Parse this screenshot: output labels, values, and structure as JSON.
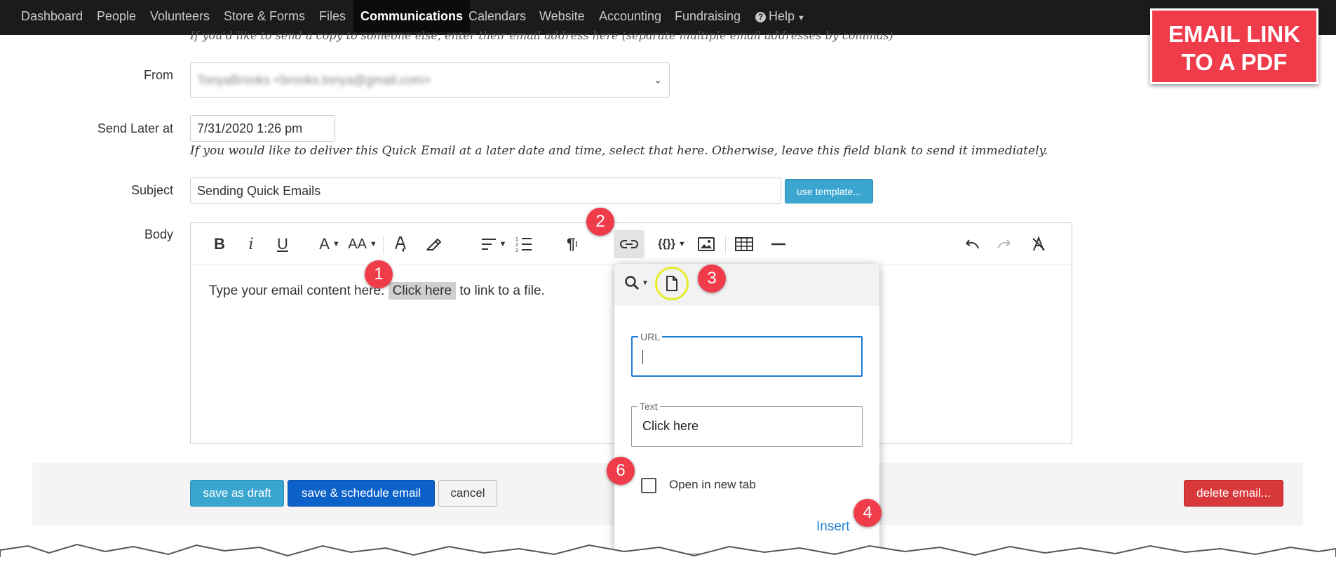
{
  "nav": {
    "items": [
      "Dashboard",
      "People",
      "Volunteers",
      "Store & Forms",
      "Files",
      "Communications",
      "Calendars",
      "Website",
      "Accounting",
      "Fundraising"
    ],
    "active": "Communications",
    "help_label": "Help"
  },
  "badge": {
    "line1": "EMAIL LINK",
    "line2": "TO A PDF"
  },
  "cc_hint": "If you'd like to send a copy to someone else, enter their email address here (separate multiple email addresses by commas)",
  "from": {
    "label": "From",
    "value": "TonyaBrooks <brooks.tonya@gmail.com>"
  },
  "send_later": {
    "label": "Send Later at",
    "value": "7/31/2020 1:26 pm",
    "hint": "If you would like to deliver this Quick Email at a later date and time, select that here. Otherwise, leave this field blank to send it immediately."
  },
  "subject": {
    "label": "Subject",
    "value": "Sending Quick Emails",
    "template_button": "use template..."
  },
  "body": {
    "label": "Body",
    "text_before": "Type your email content here.",
    "link_text": "Click here",
    "text_after": "to link to a file.",
    "toolbar_vars_label": "{{}}",
    "toolbar_para": "¶",
    "toolbar_bold": "B",
    "toolbar_italic": "i",
    "toolbar_underline": "U",
    "toolbar_font": "A",
    "toolbar_size": "AA"
  },
  "actions": {
    "save_draft": "save as draft",
    "save_schedule": "save & schedule email",
    "cancel": "cancel",
    "delete": "delete email..."
  },
  "link_popup": {
    "url_label": "URL",
    "url_value": "",
    "text_label": "Text",
    "text_value": "Click here",
    "new_tab_label": "Open in new tab",
    "insert_label": "Insert"
  },
  "callouts": [
    "1",
    "2",
    "3",
    "4",
    "6"
  ],
  "colors": {
    "nav_bg": "#1b1b1b",
    "badge_red": "#ef3b4a",
    "save_draft_blue": "#3aa6d0",
    "save_schedule_blue": "#0d62c9",
    "delete_red": "#d9383a",
    "insert_blue": "#2a86d6",
    "url_focus_blue": "#1e7bd6"
  }
}
